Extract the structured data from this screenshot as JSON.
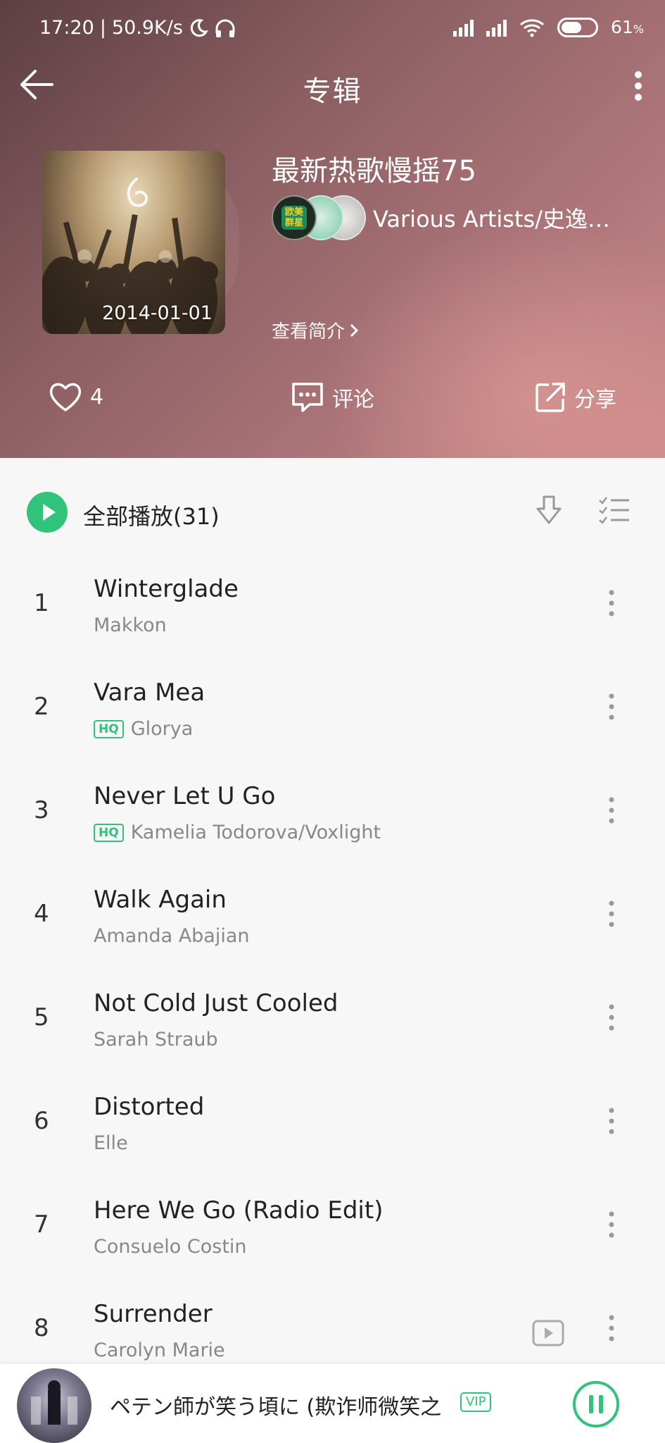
{
  "status": {
    "time": "17:20",
    "net_speed": "50.9K/s",
    "battery": "61",
    "battery_unit": "%",
    "battery_level": 0.61
  },
  "header": {
    "title": "专辑",
    "album_title": "最新热歌慢摇75",
    "artists": "Various Artists/史逸…",
    "cover_date": "2014-01-01",
    "intro_link": "查看简介",
    "avatar_badge": "欧美群星"
  },
  "actions": {
    "like_count": "4",
    "comment_label": "评论",
    "share_label": "分享"
  },
  "list": {
    "play_all_label": "全部播放(31)",
    "songs": [
      {
        "num": "1",
        "title": "Winterglade",
        "artist": "Makkon",
        "hq": false,
        "mv": false
      },
      {
        "num": "2",
        "title": "Vara Mea",
        "artist": "Glorya",
        "hq": true,
        "mv": false
      },
      {
        "num": "3",
        "title": "Never Let U Go",
        "artist": "Kamelia Todorova/Voxlight",
        "hq": true,
        "mv": false
      },
      {
        "num": "4",
        "title": "Walk Again",
        "artist": "Amanda Abajian",
        "hq": false,
        "mv": false
      },
      {
        "num": "5",
        "title": "Not Cold Just Cooled",
        "artist": "Sarah Straub",
        "hq": false,
        "mv": false
      },
      {
        "num": "6",
        "title": "Distorted",
        "artist": "Elle",
        "hq": false,
        "mv": false
      },
      {
        "num": "7",
        "title": "Here We Go (Radio Edit)",
        "artist": "Consuelo Costin",
        "hq": false,
        "mv": false
      },
      {
        "num": "8",
        "title": "Surrender",
        "artist": "Carolyn Marie",
        "hq": false,
        "mv": true
      }
    ],
    "hq_label": "HQ"
  },
  "player": {
    "now_playing": "ペテン師が笑う頃に (欺诈师微笑之",
    "vip_label": "VIP"
  },
  "colors": {
    "accent": "#31c27c",
    "header_dark": "#5c3f42",
    "header_light": "#cc8a8a"
  }
}
